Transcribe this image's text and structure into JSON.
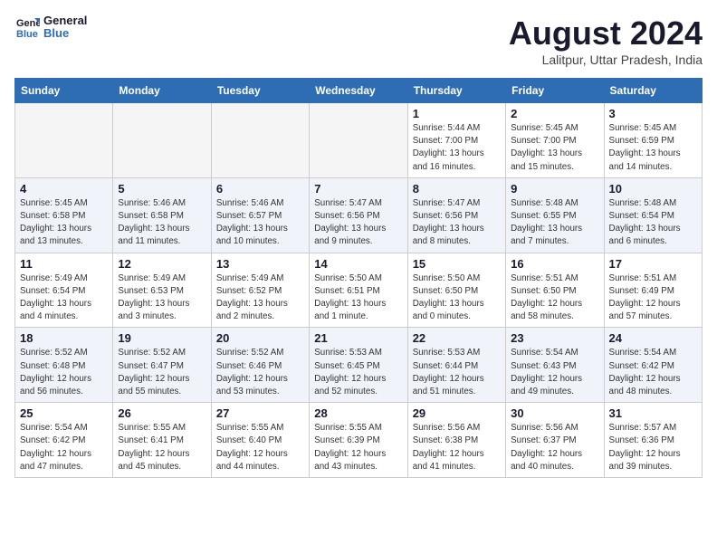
{
  "header": {
    "logo_line1": "General",
    "logo_line2": "Blue",
    "month_title": "August 2024",
    "location": "Lalitpur, Uttar Pradesh, India"
  },
  "weekdays": [
    "Sunday",
    "Monday",
    "Tuesday",
    "Wednesday",
    "Thursday",
    "Friday",
    "Saturday"
  ],
  "weeks": [
    [
      {
        "day": "",
        "info": ""
      },
      {
        "day": "",
        "info": ""
      },
      {
        "day": "",
        "info": ""
      },
      {
        "day": "",
        "info": ""
      },
      {
        "day": "1",
        "info": "Sunrise: 5:44 AM\nSunset: 7:00 PM\nDaylight: 13 hours\nand 16 minutes."
      },
      {
        "day": "2",
        "info": "Sunrise: 5:45 AM\nSunset: 7:00 PM\nDaylight: 13 hours\nand 15 minutes."
      },
      {
        "day": "3",
        "info": "Sunrise: 5:45 AM\nSunset: 6:59 PM\nDaylight: 13 hours\nand 14 minutes."
      }
    ],
    [
      {
        "day": "4",
        "info": "Sunrise: 5:45 AM\nSunset: 6:58 PM\nDaylight: 13 hours\nand 13 minutes."
      },
      {
        "day": "5",
        "info": "Sunrise: 5:46 AM\nSunset: 6:58 PM\nDaylight: 13 hours\nand 11 minutes."
      },
      {
        "day": "6",
        "info": "Sunrise: 5:46 AM\nSunset: 6:57 PM\nDaylight: 13 hours\nand 10 minutes."
      },
      {
        "day": "7",
        "info": "Sunrise: 5:47 AM\nSunset: 6:56 PM\nDaylight: 13 hours\nand 9 minutes."
      },
      {
        "day": "8",
        "info": "Sunrise: 5:47 AM\nSunset: 6:56 PM\nDaylight: 13 hours\nand 8 minutes."
      },
      {
        "day": "9",
        "info": "Sunrise: 5:48 AM\nSunset: 6:55 PM\nDaylight: 13 hours\nand 7 minutes."
      },
      {
        "day": "10",
        "info": "Sunrise: 5:48 AM\nSunset: 6:54 PM\nDaylight: 13 hours\nand 6 minutes."
      }
    ],
    [
      {
        "day": "11",
        "info": "Sunrise: 5:49 AM\nSunset: 6:54 PM\nDaylight: 13 hours\nand 4 minutes."
      },
      {
        "day": "12",
        "info": "Sunrise: 5:49 AM\nSunset: 6:53 PM\nDaylight: 13 hours\nand 3 minutes."
      },
      {
        "day": "13",
        "info": "Sunrise: 5:49 AM\nSunset: 6:52 PM\nDaylight: 13 hours\nand 2 minutes."
      },
      {
        "day": "14",
        "info": "Sunrise: 5:50 AM\nSunset: 6:51 PM\nDaylight: 13 hours\nand 1 minute."
      },
      {
        "day": "15",
        "info": "Sunrise: 5:50 AM\nSunset: 6:50 PM\nDaylight: 13 hours\nand 0 minutes."
      },
      {
        "day": "16",
        "info": "Sunrise: 5:51 AM\nSunset: 6:50 PM\nDaylight: 12 hours\nand 58 minutes."
      },
      {
        "day": "17",
        "info": "Sunrise: 5:51 AM\nSunset: 6:49 PM\nDaylight: 12 hours\nand 57 minutes."
      }
    ],
    [
      {
        "day": "18",
        "info": "Sunrise: 5:52 AM\nSunset: 6:48 PM\nDaylight: 12 hours\nand 56 minutes."
      },
      {
        "day": "19",
        "info": "Sunrise: 5:52 AM\nSunset: 6:47 PM\nDaylight: 12 hours\nand 55 minutes."
      },
      {
        "day": "20",
        "info": "Sunrise: 5:52 AM\nSunset: 6:46 PM\nDaylight: 12 hours\nand 53 minutes."
      },
      {
        "day": "21",
        "info": "Sunrise: 5:53 AM\nSunset: 6:45 PM\nDaylight: 12 hours\nand 52 minutes."
      },
      {
        "day": "22",
        "info": "Sunrise: 5:53 AM\nSunset: 6:44 PM\nDaylight: 12 hours\nand 51 minutes."
      },
      {
        "day": "23",
        "info": "Sunrise: 5:54 AM\nSunset: 6:43 PM\nDaylight: 12 hours\nand 49 minutes."
      },
      {
        "day": "24",
        "info": "Sunrise: 5:54 AM\nSunset: 6:42 PM\nDaylight: 12 hours\nand 48 minutes."
      }
    ],
    [
      {
        "day": "25",
        "info": "Sunrise: 5:54 AM\nSunset: 6:42 PM\nDaylight: 12 hours\nand 47 minutes."
      },
      {
        "day": "26",
        "info": "Sunrise: 5:55 AM\nSunset: 6:41 PM\nDaylight: 12 hours\nand 45 minutes."
      },
      {
        "day": "27",
        "info": "Sunrise: 5:55 AM\nSunset: 6:40 PM\nDaylight: 12 hours\nand 44 minutes."
      },
      {
        "day": "28",
        "info": "Sunrise: 5:55 AM\nSunset: 6:39 PM\nDaylight: 12 hours\nand 43 minutes."
      },
      {
        "day": "29",
        "info": "Sunrise: 5:56 AM\nSunset: 6:38 PM\nDaylight: 12 hours\nand 41 minutes."
      },
      {
        "day": "30",
        "info": "Sunrise: 5:56 AM\nSunset: 6:37 PM\nDaylight: 12 hours\nand 40 minutes."
      },
      {
        "day": "31",
        "info": "Sunrise: 5:57 AM\nSunset: 6:36 PM\nDaylight: 12 hours\nand 39 minutes."
      }
    ]
  ]
}
